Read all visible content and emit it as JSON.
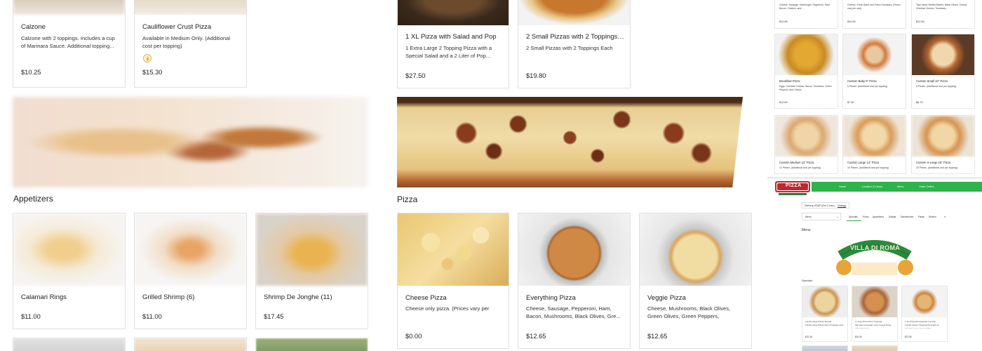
{
  "top_left": {
    "items": [
      {
        "name": "Calzone",
        "desc": "Calzone with 2 toppings. Includes a cup of Marinara Sauce. Additional topping...",
        "price": "$10.25"
      },
      {
        "name": "Cauliflower Crust Pizza",
        "desc": "Available in Medium Only. (Additional cost per topping)",
        "price": "$15.30",
        "badge": "gluten-free-icon"
      }
    ]
  },
  "top_center": {
    "items": [
      {
        "name": "1 XL Pizza with Salad and Pop",
        "desc": "1 Extra Large 2 Topping Pizza with a Special Salad and a 2 Liter of Pop...",
        "price": "$27.50"
      },
      {
        "name": "2 Small Pizzas with 2 Toppings E...",
        "desc": "2 Small Pizzas with 2 Toppings Each",
        "price": "$19.80"
      }
    ]
  },
  "appetizers": {
    "title": "Appetizers",
    "items": [
      {
        "name": "Calamari Rings",
        "price": "$11.00"
      },
      {
        "name": "Grilled Shrimp (6)",
        "price": "$11.00"
      },
      {
        "name": "Shrimp De Jonghe (11)",
        "price": "$17.45"
      }
    ]
  },
  "pizza": {
    "title": "Pizza",
    "items": [
      {
        "name": "Cheese Pizza",
        "desc": "Cheese only pizza. (Prices vary per size)",
        "price": "$0.00"
      },
      {
        "name": "Everything Pizza",
        "desc": "Cheese, Sausage, Pepperoni, Ham, Bacon, Mushrooms, Black Olives, Gre...",
        "price": "$12.65"
      },
      {
        "name": "Veggie Pizza",
        "desc": "Cheese, Mushrooms, Black Olives, Green Olives, Green Peppers, Onions,...",
        "price": "$12.65"
      }
    ]
  },
  "mini": {
    "row0": [
      {
        "desc": "Cheese, Sausage, Hamburger, Pepperoni, Ham, Bacon, Chicken, and...",
        "price": "$12.65"
      },
      {
        "desc": "Cheese, Fresh Basil, and Fresh Tomatoes. (Prices vary per size)",
        "price": "$10.65"
      },
      {
        "desc": "Taco Meat, Refried Beans, Black Olives, Onions, Cheddar Cheese, Tomatoes,...",
        "price": "$12.65"
      }
    ],
    "row1": [
      {
        "name": "Breakfast Pizza",
        "desc": "Eggs, Cheddar Cheese, Bacon, Tomatoes, Green Peppers, and Onions",
        "price": "$12.65"
      },
      {
        "name": "Custom Baby 8\" Pizza",
        "desc": "6 Pieces. (Additional cost per topping)",
        "price": "$7.32"
      },
      {
        "name": "Custom Small 10\" Pizza",
        "desc": "8 Pieces. (Additional cost per topping)",
        "price": "$8.75"
      }
    ],
    "row2": [
      {
        "name": "Custom Medium 12\" Pizza",
        "desc": "12 Pieces. (Additional cost per topping)"
      },
      {
        "name": "Custom Large 14\" Pizza",
        "desc": "16 Pieces. (Additional cost per topping)"
      },
      {
        "name": "Custom X-Large 16\" Pizza",
        "desc": "20 Pieces. (Additional cost per topping)"
      }
    ],
    "logo_text": "PIZZA",
    "nav": [
      "Home",
      "Location & Hours",
      "Menu",
      "Order Online"
    ],
    "delivery": "Delivery, ASAP (Est 1 hour)",
    "change": "Change",
    "menu_select": "Menu",
    "tabs": [
      "Specials",
      "Pizza",
      "Appetizers",
      "Salads",
      "Sandwiches",
      "Pasta",
      "Seafoo"
    ],
    "menu_heading": "Menu",
    "brand": "VILLA DI ROMA",
    "specials_title": "Specials",
    "specials": [
      {
        "desc": "2 Extra Large Pizzas Special\n2 Extra Large Pizzas with 2 Toppings each",
        "price": "$37.45"
      },
      {
        "desc": "1 Large Pizza with 2 Toppings\n(Monday & Tuesday only) 1 Large Pizza with 2 Toppings",
        "price": "$15.40"
      },
      {
        "desc": "1 XL Pizza with Appetizer and Pop\n1 Extra Large 2 Topping Pizza with an Appetizer and a 2 Liter of Pop",
        "price": "$27.50"
      }
    ]
  },
  "colors": {
    "border": "#e0e0e0",
    "nav_green": "#2db34a",
    "logo_red": "#c0272d"
  }
}
